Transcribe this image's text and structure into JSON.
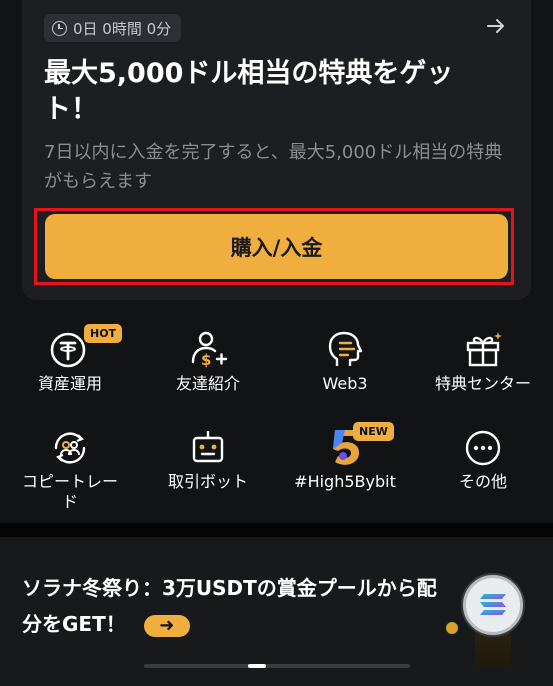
{
  "promo": {
    "countdown": "0日 0時間 0分",
    "title": "最大5,000ドル相当の特典をゲット！",
    "description": "7日以内に入金を完了すると、最大5,000ドル相当の特典がもらえます",
    "cta_label": "購入/入金"
  },
  "shortcuts": {
    "earn": {
      "label": "資産運用",
      "badge": "HOT",
      "icon": "tether-icon"
    },
    "referral": {
      "label": "友達紹介",
      "icon": "add-user-dollar-icon"
    },
    "web3": {
      "label": "Web3",
      "icon": "web3-head-icon"
    },
    "rewards": {
      "label": "特典センター",
      "icon": "gift-icon"
    },
    "copy_trade": {
      "label": "コピートレード",
      "icon": "copy-trade-icon"
    },
    "trading_bot": {
      "label": "取引ボット",
      "icon": "robot-icon"
    },
    "high5": {
      "label": "#High5Bybit",
      "badge": "NEW",
      "icon": "high5-icon"
    },
    "more": {
      "label": "その他",
      "icon": "more-dots-icon"
    }
  },
  "banner": {
    "text": "ソラナ冬祭り：3万USDTの賞金プールから配分をGET！",
    "go_icon": "arrow-right-icon"
  },
  "colors": {
    "accent": "#f0ae3f",
    "highlight_outline": "#e6131b",
    "background": "#111315",
    "card": "#1c1e21"
  }
}
